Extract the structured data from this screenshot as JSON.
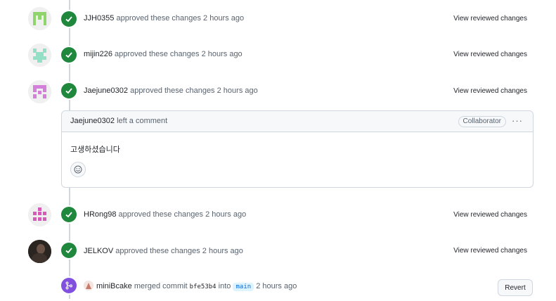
{
  "reviews": [
    {
      "author": "JJH0355",
      "action": "approved these changes",
      "time": "2 hours ago",
      "link": "View reviewed changes",
      "avatar_color": "#8fd46d"
    },
    {
      "author": "mijin226",
      "action": "approved these changes",
      "time": "2 hours ago",
      "link": "View reviewed changes",
      "avatar_color": "#94e0c6"
    },
    {
      "author": "Jaejune0302",
      "action": "approved these changes",
      "time": "2 hours ago",
      "link": "View reviewed changes",
      "avatar_color": "#d47fd9"
    },
    {
      "author": "HRong98",
      "action": "approved these changes",
      "time": "2 hours ago",
      "link": "View reviewed changes",
      "avatar_color": "#d65bb9"
    },
    {
      "author": "JELKOV",
      "action": "approved these changes",
      "time": "2 hours ago",
      "link": "View reviewed changes",
      "avatar_color": "#2b2522"
    }
  ],
  "comment": {
    "author": "Jaejune0302",
    "action": "left a comment",
    "role": "Collaborator",
    "body": "고생하셨습니다",
    "menu": "···"
  },
  "merge": {
    "author": "miniBcake",
    "action": "merged commit",
    "commit": "bfe53b4",
    "into": "into",
    "branch": "main",
    "time": "2 hours ago",
    "revert_label": "Revert"
  },
  "colors": {
    "approved": "#1f883d",
    "merged": "#8250df",
    "link": "#0969da"
  }
}
